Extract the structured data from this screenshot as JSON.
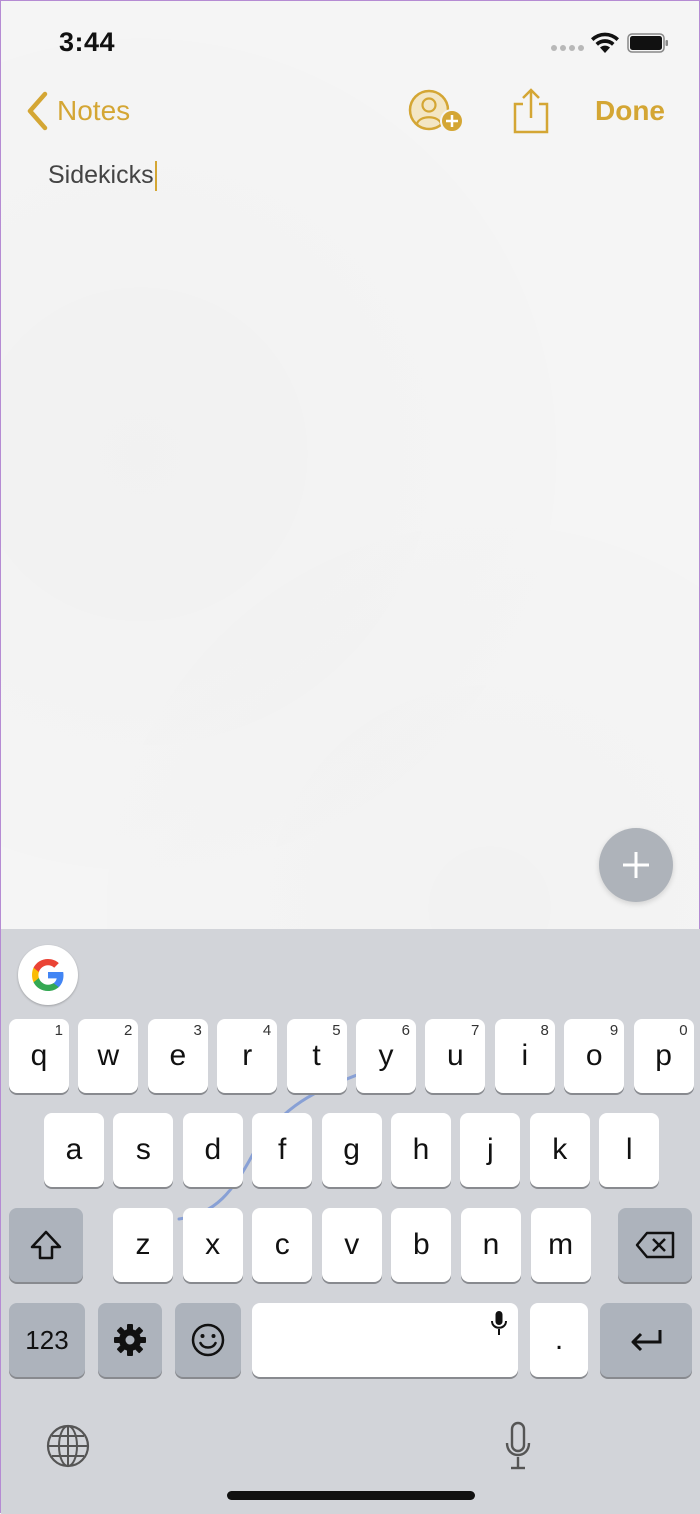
{
  "status_bar": {
    "time": "3:44"
  },
  "nav": {
    "back_label": "Notes",
    "done_label": "Done"
  },
  "note": {
    "text": "Sidekicks"
  },
  "keyboard": {
    "row1": [
      {
        "key": "q",
        "hint": "1"
      },
      {
        "key": "w",
        "hint": "2"
      },
      {
        "key": "e",
        "hint": "3"
      },
      {
        "key": "r",
        "hint": "4"
      },
      {
        "key": "t",
        "hint": "5"
      },
      {
        "key": "y",
        "hint": "6"
      },
      {
        "key": "u",
        "hint": "7"
      },
      {
        "key": "i",
        "hint": "8"
      },
      {
        "key": "o",
        "hint": "9"
      },
      {
        "key": "p",
        "hint": "0"
      }
    ],
    "row2": [
      "a",
      "s",
      "d",
      "f",
      "g",
      "h",
      "j",
      "k",
      "l"
    ],
    "row3": [
      "z",
      "x",
      "c",
      "v",
      "b",
      "n",
      "m"
    ],
    "numbers_label": "123",
    "period_label": "."
  },
  "colors": {
    "accent": "#d4a634",
    "keyboard_bg": "#d2d4d9",
    "key_dark": "#adb3bc"
  },
  "icons": [
    "back-chevron-icon",
    "add-person-icon",
    "share-icon",
    "plus-icon",
    "google-icon",
    "shift-icon",
    "backspace-icon",
    "gear-icon",
    "emoji-icon",
    "mic-icon",
    "return-icon",
    "globe-icon"
  ]
}
